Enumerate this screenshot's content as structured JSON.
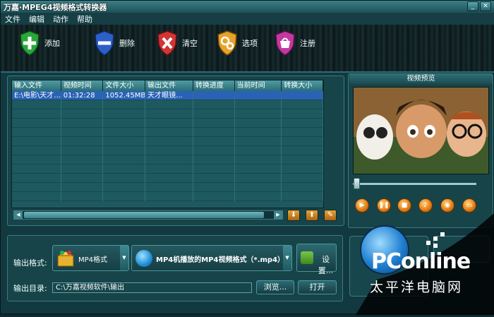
{
  "window": {
    "title": "万嘉·MPEG4视频格式转换器"
  },
  "menu": [
    "文件",
    "编辑",
    "动作",
    "帮助"
  ],
  "toolbar": {
    "add": "添加",
    "delete": "删除",
    "clear": "清空",
    "options": "选项",
    "register": "注册"
  },
  "grid": {
    "columns": [
      "输入文件",
      "视频时间",
      "文件大小",
      "输出文件",
      "转换进度",
      "当前时间",
      "转换大小"
    ],
    "rows": [
      [
        "E:\\电影\\天才...",
        "01:32:28",
        "1052.45MB",
        "天才眼镜...",
        "",
        "",
        ""
      ]
    ]
  },
  "preview": {
    "title": "视频预览"
  },
  "output": {
    "format_label": "输出格式:",
    "format_value": "MP4格式",
    "profile_value": "MP4机播放的MP4视频格式（*.mp4）",
    "settings_label": "设置...",
    "dir_label": "输出目录:",
    "dir_value": "C:\\万嘉视频软件\\输出",
    "browse_label": "浏览...",
    "open_label": "打开"
  },
  "watermark": {
    "brand": "PConline",
    "tagline": "太平洋电脑网"
  },
  "colors": {
    "accent": "#2a62b6",
    "panel": "#164449",
    "orange": "#e07a12"
  }
}
